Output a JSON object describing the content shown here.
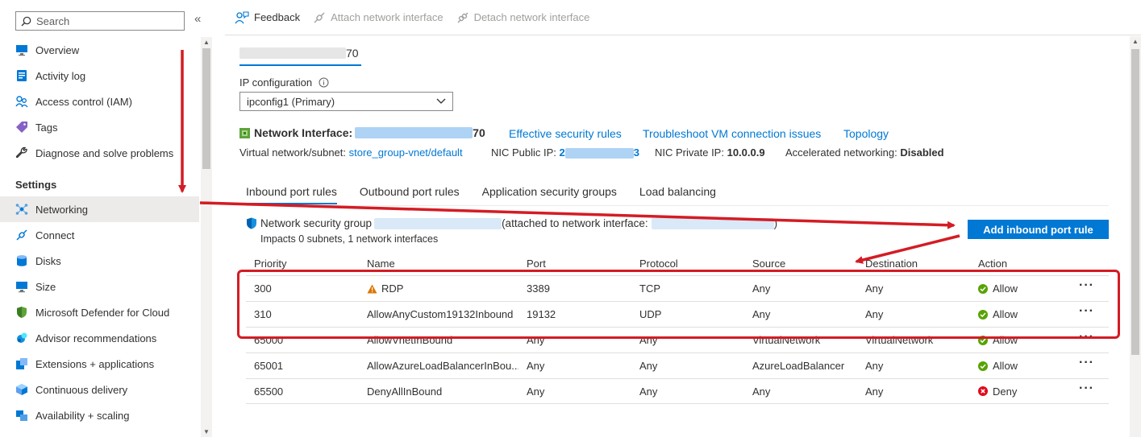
{
  "sidebar": {
    "search_placeholder": "Search",
    "collapse": "«",
    "items": [
      {
        "label": "Overview",
        "icon": "monitor-icon"
      },
      {
        "label": "Activity log",
        "icon": "activity-log-icon"
      },
      {
        "label": "Access control (IAM)",
        "icon": "people-icon"
      },
      {
        "label": "Tags",
        "icon": "tag-icon"
      },
      {
        "label": "Diagnose and solve problems",
        "icon": "wrench-icon"
      }
    ],
    "section": "Settings",
    "settings_items": [
      {
        "label": "Networking",
        "icon": "networking-icon",
        "active": true
      },
      {
        "label": "Connect",
        "icon": "connect-icon"
      },
      {
        "label": "Disks",
        "icon": "disks-icon"
      },
      {
        "label": "Size",
        "icon": "monitor-icon"
      },
      {
        "label": "Microsoft Defender for Cloud",
        "icon": "shield-icon"
      },
      {
        "label": "Advisor recommendations",
        "icon": "advisor-icon"
      },
      {
        "label": "Extensions + applications",
        "icon": "extensions-icon"
      },
      {
        "label": "Continuous delivery",
        "icon": "cube-icon"
      },
      {
        "label": "Availability + scaling",
        "icon": "availability-icon"
      }
    ]
  },
  "toolbar": {
    "feedback": "Feedback",
    "attach": "Attach network interface",
    "detach": "Detach network interface"
  },
  "nic_tab": {
    "suffix": "70"
  },
  "ip_config": {
    "label": "IP configuration",
    "selected": "ipconfig1 (Primary)"
  },
  "nic": {
    "label": "Network Interface:",
    "name_suffix": "70",
    "links": [
      "Effective security rules",
      "Troubleshoot VM connection issues",
      "Topology"
    ]
  },
  "details": {
    "vnet_label": "Virtual network/subnet:",
    "vnet_value": "store_group-vnet/default",
    "public_ip_label": "NIC Public IP:",
    "public_ip_prefix": "2",
    "public_ip_suffix": "3",
    "private_ip_label": "NIC Private IP:",
    "private_ip_value": "10.0.0.9",
    "accel_label": "Accelerated networking:",
    "accel_value": "Disabled"
  },
  "tabs": [
    "Inbound port rules",
    "Outbound port rules",
    "Application security groups",
    "Load balancing"
  ],
  "nsg": {
    "prefix": "Network security group",
    "attached_prefix": "(attached to network interface:",
    "attached_suffix": ")",
    "impacts": "Impacts 0 subnets, 1 network interfaces"
  },
  "add_rule_button": "Add inbound port rule",
  "table": {
    "headers": [
      "Priority",
      "Name",
      "Port",
      "Protocol",
      "Source",
      "Destination",
      "Action"
    ],
    "rows": [
      {
        "priority": "300",
        "name": "RDP",
        "warn": true,
        "port": "3389",
        "protocol": "TCP",
        "source": "Any",
        "destination": "Any",
        "action": "Allow"
      },
      {
        "priority": "310",
        "name": "AllowAnyCustom19132Inbound",
        "warn": false,
        "port": "19132",
        "protocol": "UDP",
        "source": "Any",
        "destination": "Any",
        "action": "Allow"
      },
      {
        "priority": "65000",
        "name": "AllowVnetInBound",
        "warn": false,
        "port": "Any",
        "protocol": "Any",
        "source": "VirtualNetwork",
        "destination": "VirtualNetwork",
        "action": "Allow"
      },
      {
        "priority": "65001",
        "name": "AllowAzureLoadBalancerInBou...",
        "warn": false,
        "port": "Any",
        "protocol": "Any",
        "source": "AzureLoadBalancer",
        "destination": "Any",
        "action": "Allow"
      },
      {
        "priority": "65500",
        "name": "DenyAllInBound",
        "warn": false,
        "port": "Any",
        "protocol": "Any",
        "source": "Any",
        "destination": "Any",
        "action": "Deny"
      }
    ],
    "more": "···"
  },
  "colors": {
    "accent": "#0078d4",
    "allow": "#57a300",
    "deny": "#e00b1c",
    "annotation": "#d41c24"
  }
}
